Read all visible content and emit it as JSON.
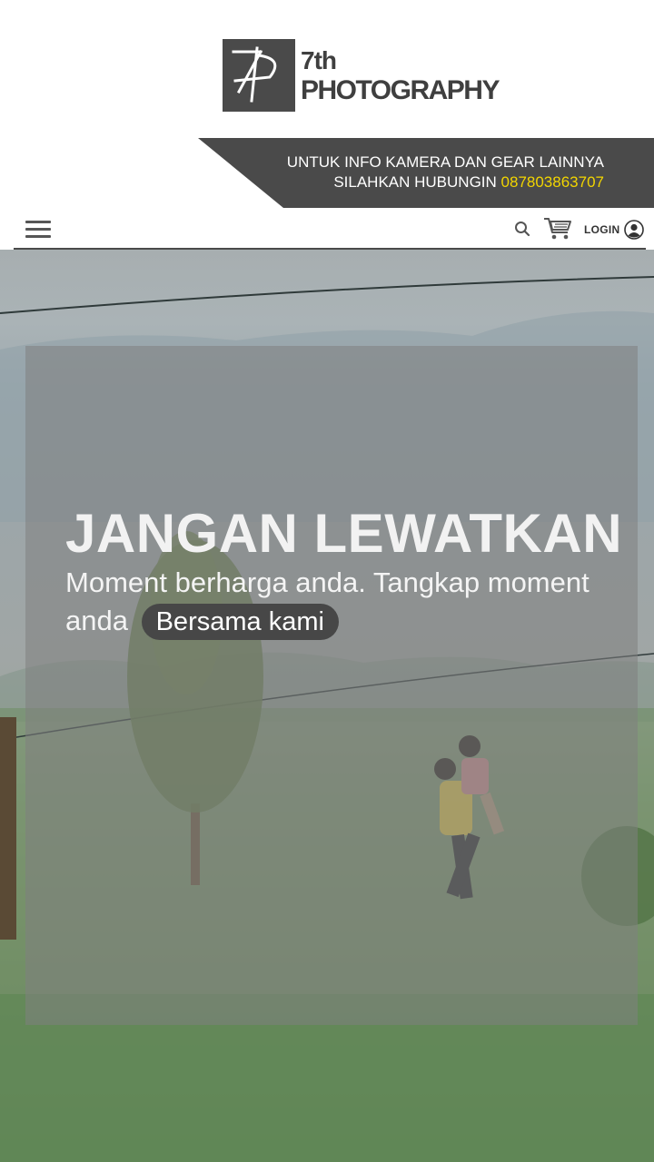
{
  "logo": {
    "line1": "7th",
    "line2": "PHOTOGRAPHY"
  },
  "banner": {
    "line1": "UNTUK INFO KAMERA DAN GEAR LAINNYA",
    "line2_prefix": "SILAHKAN HUBUNGIN",
    "phone": "087803863707",
    "phone_color": "#f2d500"
  },
  "nav": {
    "menu_icon": "hamburger-menu-icon",
    "search_icon": "search-icon",
    "cart_icon": "shopping-cart-icon",
    "login_label": "LOGIN",
    "user_icon": "user-circle-icon"
  },
  "hero": {
    "headline": "JANGAN LEWATKAN",
    "subline_text": "Moment berharga anda. Tangkap moment anda",
    "cta_label": "Bersama kami"
  },
  "colors": {
    "dark_gray": "#4a4a4a",
    "accent_yellow": "#f2d500",
    "white": "#ffffff"
  }
}
